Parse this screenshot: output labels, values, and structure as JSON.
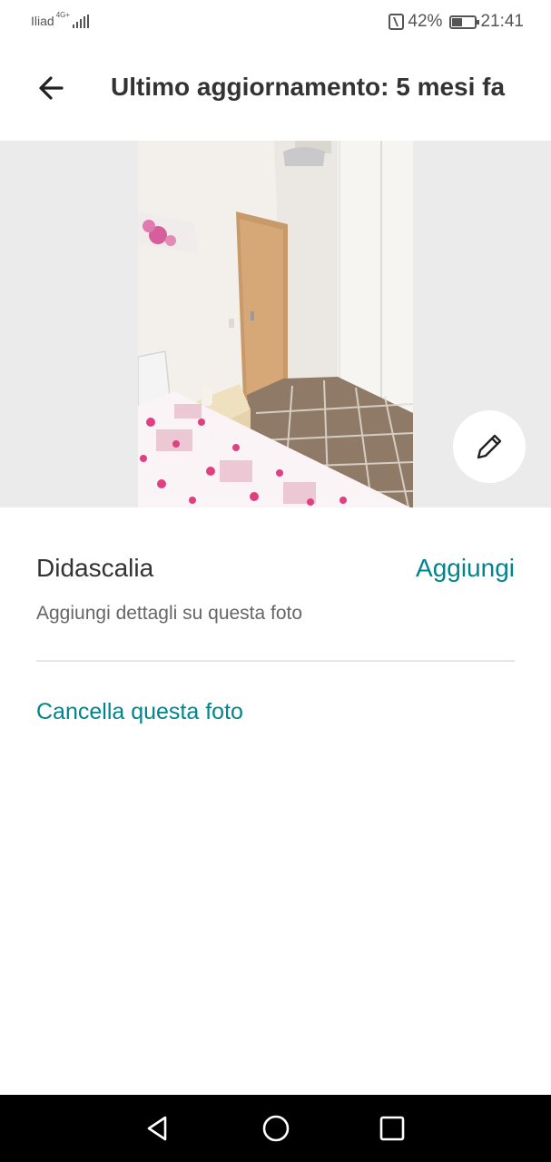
{
  "status_bar": {
    "carrier": "Iliad",
    "network_type": "4G+",
    "nfc_icon": "nfc-icon",
    "battery_percent": "42%",
    "battery_level": 0.42,
    "time": "21:41"
  },
  "app_bar": {
    "back_icon": "arrow-left-icon",
    "title": "Ultimo aggiornamento: 5 mesi fa"
  },
  "photo": {
    "edit_icon": "pencil-icon",
    "background_color": "#ebebeb"
  },
  "caption": {
    "heading": "Didascalia",
    "action_label": "Aggiungi",
    "hint": "Aggiungi dettagli su questa foto"
  },
  "delete_label": "Cancella questa foto",
  "colors": {
    "accent": "#00858c",
    "title_text": "#333333",
    "secondary_text": "#666666",
    "divider": "#e6e6e6",
    "nav_bar": "#000000"
  },
  "nav_bar": {
    "back_icon": "triangle-back-icon",
    "home_icon": "circle-home-icon",
    "recents_icon": "square-recents-icon"
  }
}
